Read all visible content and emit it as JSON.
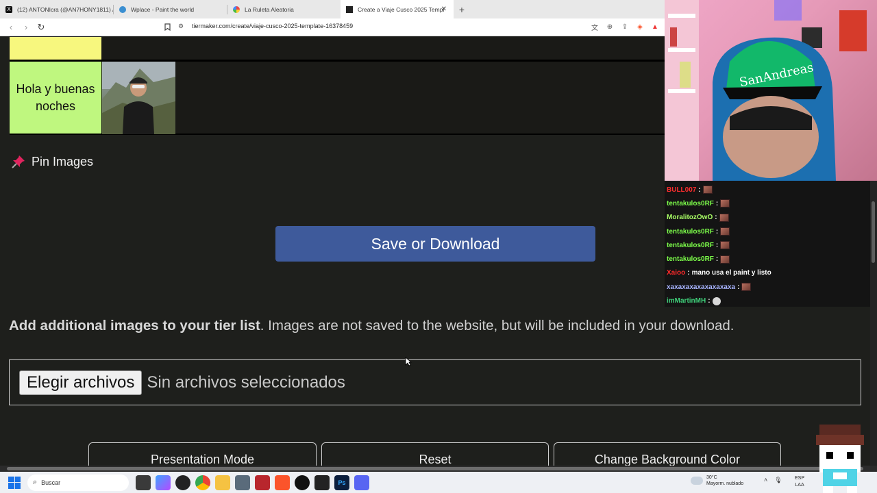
{
  "browser": {
    "tabs": [
      {
        "label": "(12) ANTONIcra (@AN7HONY1811) /",
        "icon": "x-logo-icon",
        "active": false
      },
      {
        "label": "Wplace - Paint the world",
        "icon": "globe-icon",
        "active": false
      },
      {
        "label": "La Ruleta Aleatoria",
        "icon": "wheel-icon",
        "active": false
      },
      {
        "label": "Create a Viaje Cusco 2025 Templ",
        "icon": "tiermaker-icon",
        "active": true
      }
    ],
    "url": "tiermaker.com/create/viaje-cusco-2025-template-16378459"
  },
  "tiers": [
    {
      "label": "",
      "color": "#f7f77e"
    },
    {
      "label": "Hola y buenas noches",
      "color": "#bff77f"
    }
  ],
  "pin_images": {
    "label": "Pin Images",
    "icon": "pushpin-icon"
  },
  "save_button": {
    "label": "Save or Download",
    "color": "#3e5a9b"
  },
  "info": {
    "bold": "Add additional images to your tier list",
    "rest": ". Images are not saved to the website, but will be included in your download."
  },
  "file_input": {
    "button_label": "Elegir archivos",
    "status": "Sin archivos seleccionados"
  },
  "bottom_buttons": [
    {
      "label": "Presentation Mode"
    },
    {
      "label": "Reset"
    },
    {
      "label": "Change Background Color"
    }
  ],
  "chat": [
    {
      "user": "BULL007",
      "color": "#ff2d2d",
      "message": "",
      "emote": "emote"
    },
    {
      "user": "tentakulos0RF",
      "color": "#7dff4a",
      "message": "",
      "emote": "emote"
    },
    {
      "user": "MoralitozOwO",
      "color": "#aaff66",
      "message": "",
      "emote": "emote"
    },
    {
      "user": "tentakulos0RF",
      "color": "#7dff4a",
      "message": "",
      "emote": "emote"
    },
    {
      "user": "tentakulos0RF",
      "color": "#7dff4a",
      "message": "",
      "emote": "emote"
    },
    {
      "user": "tentakulos0RF",
      "color": "#7dff4a",
      "message": "",
      "emote": "emote"
    },
    {
      "user": "Xaioo",
      "color": "#ff2a2a",
      "message": "mano usa el paint y listo",
      "emote": ""
    },
    {
      "user": "xaxaxaxaxaxaxaxaxa",
      "color": "#a8b4ff",
      "message": "",
      "emote": "emote"
    },
    {
      "user": "imMartinMH",
      "color": "#3fd07a",
      "message": "",
      "emote": "emote2"
    }
  ],
  "taskbar": {
    "search_placeholder": "Buscar",
    "weather_temp": "30°C",
    "weather_desc": "Mayorm. nublado",
    "lang_top": "ESP",
    "lang_bottom": "LAA"
  }
}
